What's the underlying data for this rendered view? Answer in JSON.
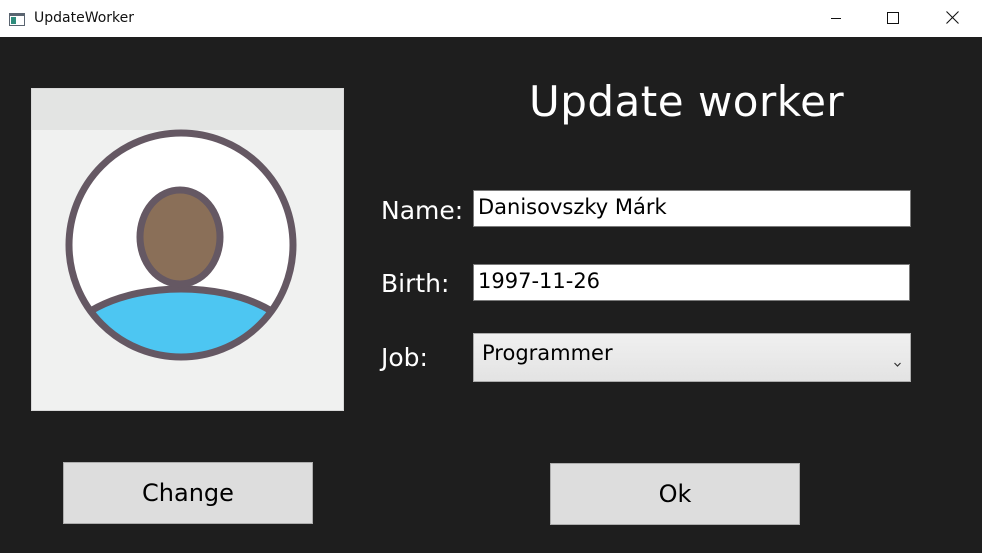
{
  "window": {
    "title": "UpdateWorker",
    "icons": {
      "app": "app-window-icon",
      "minimize": "minimize-icon",
      "maximize": "maximize-icon",
      "close": "close-icon"
    }
  },
  "form": {
    "heading": "Update worker",
    "photo": {
      "icon": "user-avatar-icon",
      "colors": {
        "outline": "#655863",
        "head": "#8a6f58",
        "body": "#4dc6f2",
        "background": "#f0f1f0"
      }
    },
    "name_label": "Name:",
    "name_value": "Danisovszky Márk",
    "birth_label": "Birth:",
    "birth_value": "1997-11-26",
    "job_label": "Job:",
    "job_value": "Programmer",
    "change_button": "Change",
    "ok_button": "Ok"
  },
  "colors": {
    "background": "#1e1e1e",
    "titlebar": "#ffffff",
    "button": "#dddddd",
    "text_on_dark": "#ffffff"
  }
}
